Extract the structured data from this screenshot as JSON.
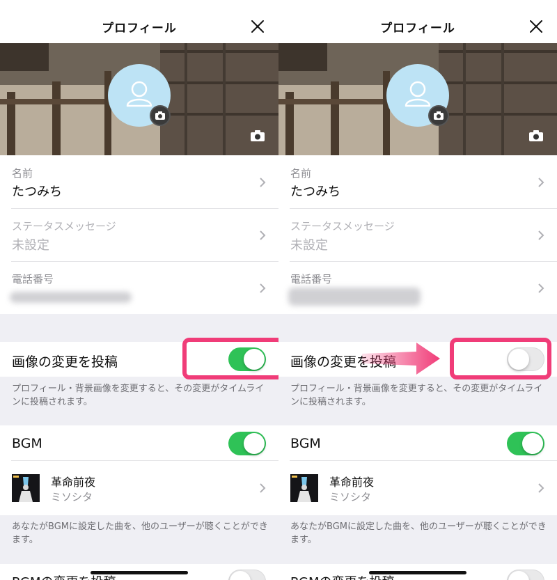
{
  "nav": {
    "title": "プロフィール",
    "close_icon": "close-icon"
  },
  "profile": {
    "name_label": "名前",
    "name_value": "たつみち",
    "status_label": "ステータスメッセージ",
    "status_value": "未設定",
    "phone_label": "電話番号"
  },
  "image_post": {
    "label": "画像の変更を投稿",
    "note": "プロフィール・背景画像を変更すると、その変更がタイムラインに投稿されます。",
    "left_state": "on",
    "right_state": "off"
  },
  "bgm": {
    "label": "BGM",
    "state": "on",
    "song_title": "革命前夜",
    "song_artist": "ミソシタ",
    "note": "あなたがBGMに設定した曲を、他のユーザーが聴くことができます。",
    "next_label": "BGMの変更を投稿"
  },
  "colors": {
    "toggle_on": "#2fc257",
    "highlight": "#f03c78",
    "avatar_bg": "#bde3f5"
  }
}
